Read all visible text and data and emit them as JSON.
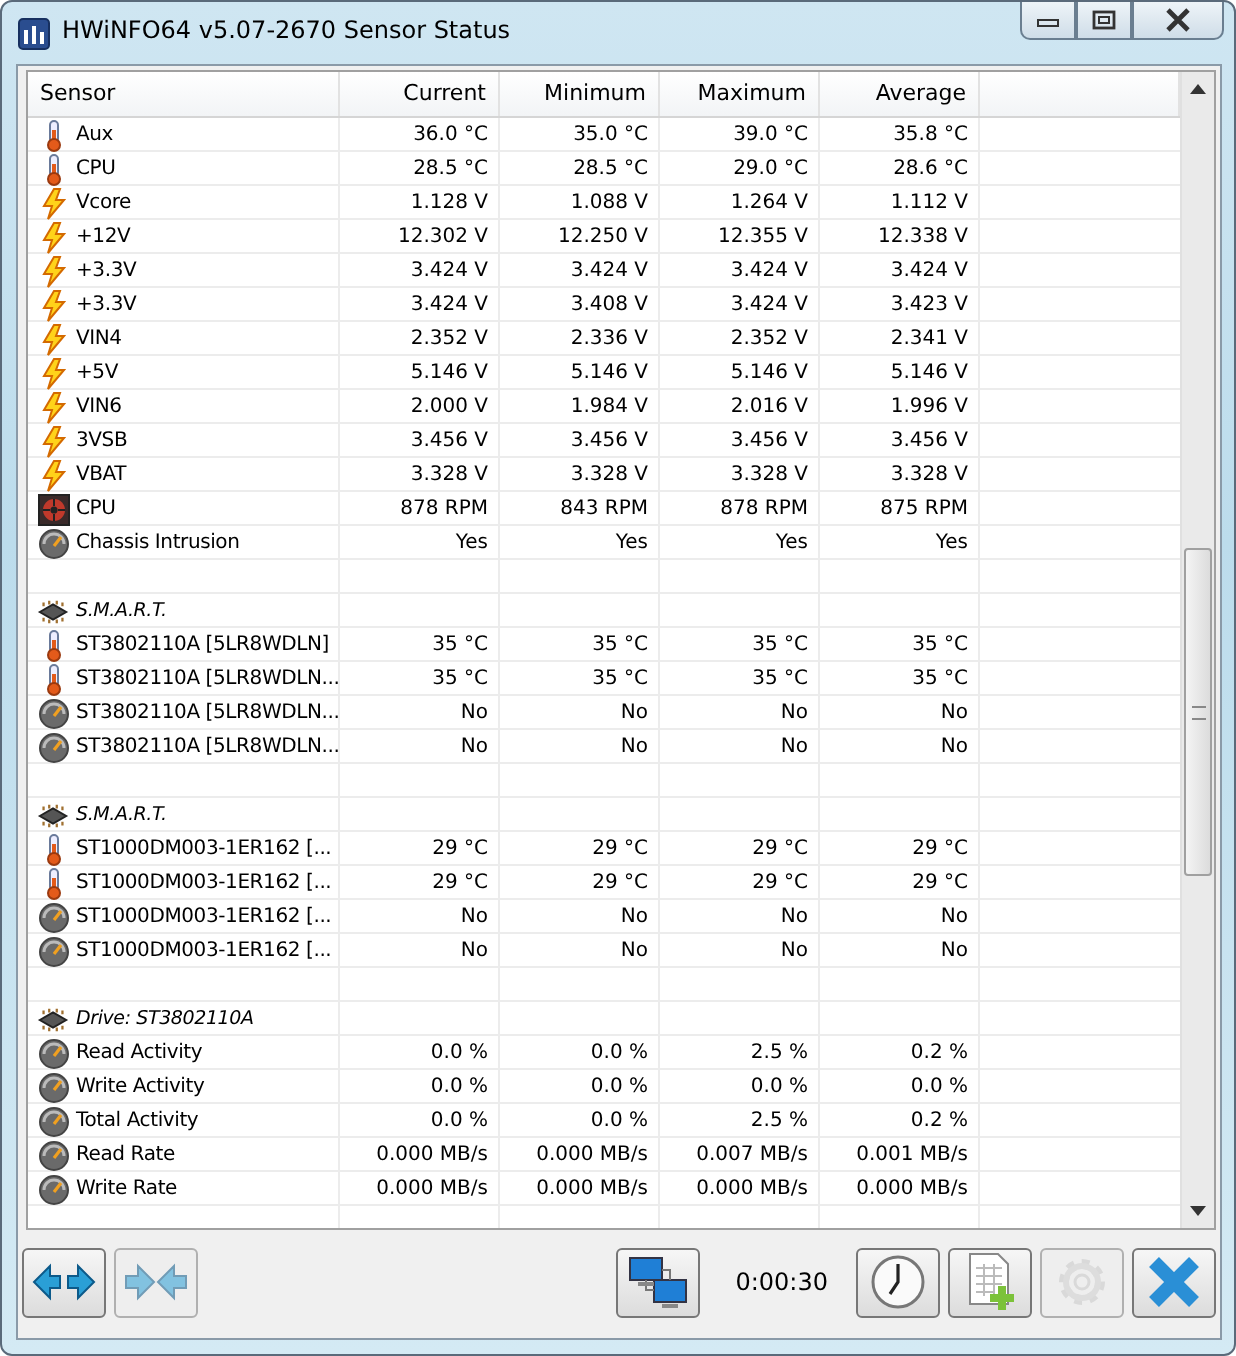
{
  "window": {
    "title": "HWiNFO64 v5.07-2670 Sensor Status"
  },
  "table": {
    "columns": [
      "Sensor",
      "Current",
      "Minimum",
      "Maximum",
      "Average"
    ],
    "rows": [
      {
        "kind": "temp",
        "label": "Aux",
        "values": [
          "36.0 °C",
          "35.0 °C",
          "39.0 °C",
          "35.8 °C"
        ]
      },
      {
        "kind": "temp",
        "label": "CPU",
        "values": [
          "28.5 °C",
          "28.5 °C",
          "29.0 °C",
          "28.6 °C"
        ]
      },
      {
        "kind": "volt",
        "label": "Vcore",
        "values": [
          "1.128 V",
          "1.088 V",
          "1.264 V",
          "1.112 V"
        ]
      },
      {
        "kind": "volt",
        "label": "+12V",
        "values": [
          "12.302 V",
          "12.250 V",
          "12.355 V",
          "12.338 V"
        ]
      },
      {
        "kind": "volt",
        "label": "+3.3V",
        "values": [
          "3.424 V",
          "3.424 V",
          "3.424 V",
          "3.424 V"
        ]
      },
      {
        "kind": "volt",
        "label": "+3.3V",
        "values": [
          "3.424 V",
          "3.408 V",
          "3.424 V",
          "3.423 V"
        ]
      },
      {
        "kind": "volt",
        "label": "VIN4",
        "values": [
          "2.352 V",
          "2.336 V",
          "2.352 V",
          "2.341 V"
        ]
      },
      {
        "kind": "volt",
        "label": "+5V",
        "values": [
          "5.146 V",
          "5.146 V",
          "5.146 V",
          "5.146 V"
        ]
      },
      {
        "kind": "volt",
        "label": "VIN6",
        "values": [
          "2.000 V",
          "1.984 V",
          "2.016 V",
          "1.996 V"
        ]
      },
      {
        "kind": "volt",
        "label": "3VSB",
        "values": [
          "3.456 V",
          "3.456 V",
          "3.456 V",
          "3.456 V"
        ]
      },
      {
        "kind": "volt",
        "label": "VBAT",
        "values": [
          "3.328 V",
          "3.328 V",
          "3.328 V",
          "3.328 V"
        ]
      },
      {
        "kind": "fan",
        "label": "CPU",
        "values": [
          "878 RPM",
          "843 RPM",
          "878 RPM",
          "875 RPM"
        ]
      },
      {
        "kind": "gauge",
        "label": "Chassis Intrusion",
        "values": [
          "Yes",
          "Yes",
          "Yes",
          "Yes"
        ]
      },
      {
        "kind": "blank"
      },
      {
        "kind": "group",
        "label": "S.M.A.R.T."
      },
      {
        "kind": "temp",
        "label": "ST3802110A [5LR8WDLN]",
        "values": [
          "35 °C",
          "35 °C",
          "35 °C",
          "35 °C"
        ]
      },
      {
        "kind": "temp",
        "label": "ST3802110A [5LR8WDLN...",
        "values": [
          "35 °C",
          "35 °C",
          "35 °C",
          "35 °C"
        ]
      },
      {
        "kind": "gauge",
        "label": "ST3802110A [5LR8WDLN...",
        "values": [
          "No",
          "No",
          "No",
          "No"
        ]
      },
      {
        "kind": "gauge",
        "label": "ST3802110A [5LR8WDLN...",
        "values": [
          "No",
          "No",
          "No",
          "No"
        ]
      },
      {
        "kind": "blank"
      },
      {
        "kind": "group",
        "label": "S.M.A.R.T."
      },
      {
        "kind": "temp",
        "label": "ST1000DM003-1ER162 [...",
        "values": [
          "29 °C",
          "29 °C",
          "29 °C",
          "29 °C"
        ]
      },
      {
        "kind": "temp",
        "label": "ST1000DM003-1ER162 [...",
        "values": [
          "29 °C",
          "29 °C",
          "29 °C",
          "29 °C"
        ]
      },
      {
        "kind": "gauge",
        "label": "ST1000DM003-1ER162 [...",
        "values": [
          "No",
          "No",
          "No",
          "No"
        ]
      },
      {
        "kind": "gauge",
        "label": "ST1000DM003-1ER162 [...",
        "values": [
          "No",
          "No",
          "No",
          "No"
        ]
      },
      {
        "kind": "blank"
      },
      {
        "kind": "group",
        "label": "Drive: ST3802110A"
      },
      {
        "kind": "gauge",
        "label": "Read Activity",
        "values": [
          "0.0 %",
          "0.0 %",
          "2.5 %",
          "0.2 %"
        ]
      },
      {
        "kind": "gauge",
        "label": "Write Activity",
        "values": [
          "0.0 %",
          "0.0 %",
          "0.0 %",
          "0.0 %"
        ]
      },
      {
        "kind": "gauge",
        "label": "Total Activity",
        "values": [
          "0.0 %",
          "0.0 %",
          "2.5 %",
          "0.2 %"
        ]
      },
      {
        "kind": "gauge",
        "label": "Read Rate",
        "values": [
          "0.000 MB/s",
          "0.000 MB/s",
          "0.007 MB/s",
          "0.001 MB/s"
        ]
      },
      {
        "kind": "gauge",
        "label": "Write Rate",
        "values": [
          "0.000 MB/s",
          "0.000 MB/s",
          "0.000 MB/s",
          "0.000 MB/s"
        ]
      }
    ]
  },
  "toolbar": {
    "left": [
      {
        "kind": "expand",
        "disabled": false
      },
      {
        "kind": "collapse",
        "disabled": true
      }
    ],
    "right": [
      {
        "kind": "network",
        "disabled": false
      },
      {
        "kind": "timer",
        "text": "0:00:30"
      },
      {
        "kind": "clock",
        "disabled": false
      },
      {
        "kind": "report",
        "disabled": false
      },
      {
        "kind": "settings",
        "disabled": true
      },
      {
        "kind": "close",
        "disabled": false
      }
    ]
  }
}
